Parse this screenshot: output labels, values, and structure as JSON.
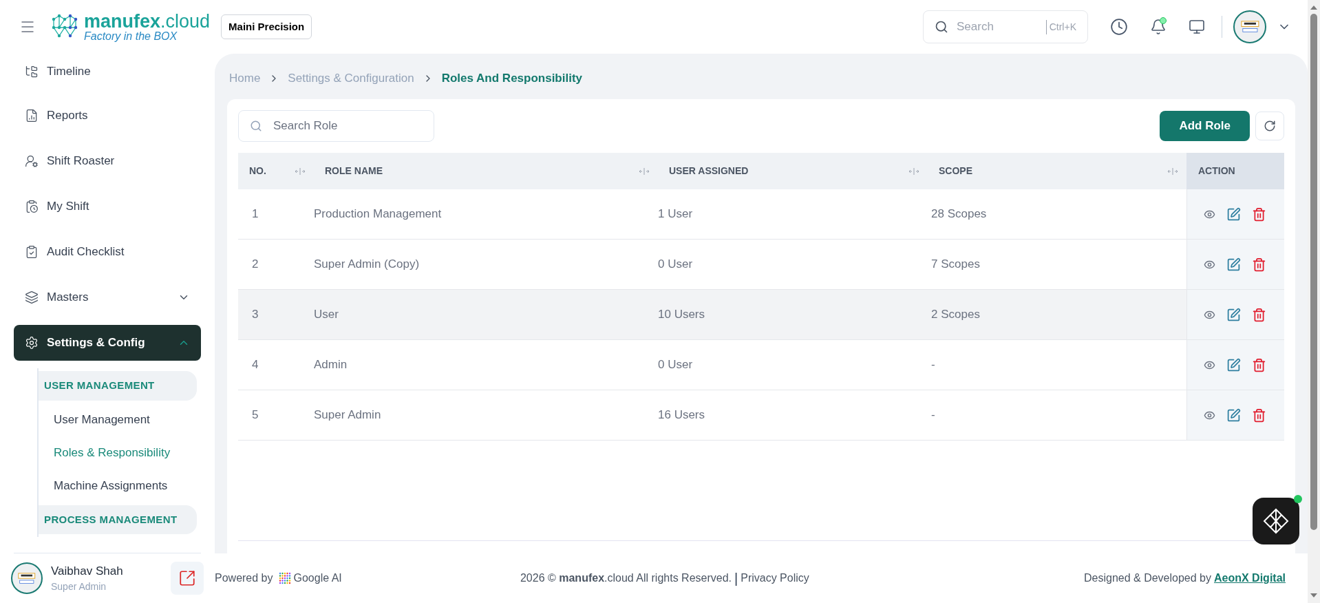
{
  "header": {
    "brand": "**manufex**.cloud",
    "tagline": "Factory in the BOX",
    "company": "Maini Precision",
    "search": {
      "placeholder": "Search",
      "shortcut": "Ctrl+K"
    },
    "notification_dot": true
  },
  "sidebar": {
    "items": [
      {
        "label": "Timeline",
        "selected": false
      },
      {
        "label": "Reports",
        "selected": false
      },
      {
        "label": "Shift Roaster",
        "selected": false
      },
      {
        "label": "My Shift",
        "selected": false
      },
      {
        "label": "Audit Checklist",
        "selected": false
      },
      {
        "label": "Masters",
        "expanded": false,
        "selected": false
      },
      {
        "label": "Settings & Config",
        "expanded": true,
        "selected": true,
        "children": [
          {
            "kind": "group",
            "label": "USER MANAGEMENT"
          },
          {
            "kind": "link",
            "label": "User Management",
            "selected": false
          },
          {
            "kind": "link",
            "label": "Roles & Responsibility",
            "selected": true
          },
          {
            "kind": "link",
            "label": "Machine Assignments",
            "selected": false
          },
          {
            "kind": "group",
            "label": "PROCESS MANAGEMENT"
          }
        ]
      }
    ],
    "user": {
      "name": "Vaibhav Shah",
      "role": "Super Admin"
    }
  },
  "breadcrumb": [
    {
      "label": "Home",
      "selected": false
    },
    {
      "label": "Settings & Configuration",
      "selected": false
    },
    {
      "label": "Roles And Responsibility",
      "selected": true
    }
  ],
  "toolbar": {
    "search": {
      "placeholder": "Search Role"
    },
    "add_button": "Add Role"
  },
  "table": {
    "columns": [
      "NO.",
      "ROLE NAME",
      "USER ASSIGNED",
      "SCOPE",
      "ACTION"
    ],
    "rows": [
      {
        "no": "1",
        "role": "Production Management",
        "users": "1 User",
        "scope": "28 Scopes",
        "highlighted": false
      },
      {
        "no": "2",
        "role": "Super Admin (Copy)",
        "users": "0 User",
        "scope": "7 Scopes",
        "highlighted": false
      },
      {
        "no": "3",
        "role": "User",
        "users": "10 Users",
        "scope": "2 Scopes",
        "highlighted": true
      },
      {
        "no": "4",
        "role": "Admin",
        "users": "0 User",
        "scope": "-",
        "highlighted": false
      },
      {
        "no": "5",
        "role": "Super Admin",
        "users": "16 Users",
        "scope": "-",
        "highlighted": false
      }
    ]
  },
  "footer": {
    "powered_by": "Powered by",
    "ai_name": "Google AI",
    "copyright": "2026 © **manufex**.cloud All rights Reserved.",
    "separator": "|",
    "privacy": "Privacy Policy",
    "designed_by": "Designed & Developed by",
    "company_link": "AeonX Digital"
  }
}
